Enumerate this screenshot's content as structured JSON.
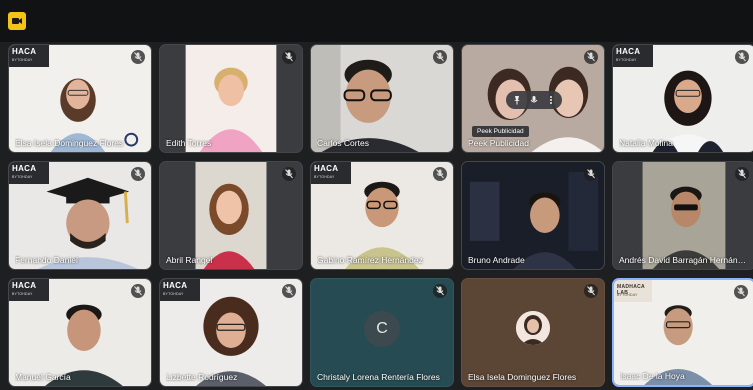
{
  "app": {
    "icon": "meet-app-icon"
  },
  "tooltip": {
    "text": "Peek Publicidad"
  },
  "tiles": [
    {
      "name": "Elsa Isela Dominguez Flores",
      "logo": "HACA",
      "logo_sub": "BYTOHDAY"
    },
    {
      "name": "Edith Torres"
    },
    {
      "name": "Carlos Cortes"
    },
    {
      "name": "Peek Publicidad"
    },
    {
      "name": "Natalia Molina",
      "logo": "HACA",
      "logo_sub": "BYTOHDAY"
    },
    {
      "name": "Fernando Daniel",
      "logo": "HACA",
      "logo_sub": "BYTOHDAY"
    },
    {
      "name": "Abril Rangel"
    },
    {
      "name": "Gabino Ramírez Hernández",
      "logo": "HACA",
      "logo_sub": "BYTOHDAY"
    },
    {
      "name": "Bruno Andrade"
    },
    {
      "name": "Andrés David Barragán Hernández"
    },
    {
      "name": "Manuel García",
      "logo": "HACA",
      "logo_sub": "BYTOHDAY"
    },
    {
      "name": "Lizbette Rodríguez",
      "logo": "HACA",
      "logo_sub": "BYTOHDAY"
    },
    {
      "name": "Christaly Lorena Rentería Flores",
      "initial": "C"
    },
    {
      "name": "Elsa Isela Dominguez Flores"
    },
    {
      "name": "Isaac De la Hoya",
      "logo": "MADHACA LAB",
      "logo_sub": "BYTOHDAY"
    }
  ],
  "colors": {
    "background": "#1e1f21",
    "topbar": "#111214",
    "accent": "#f3c318",
    "active_border": "#8ab4f8"
  }
}
